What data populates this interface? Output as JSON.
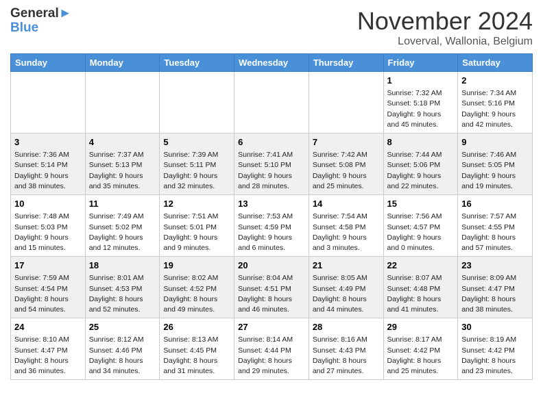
{
  "header": {
    "logo_line1": "General",
    "logo_line2": "Blue",
    "month": "November 2024",
    "location": "Loverval, Wallonia, Belgium"
  },
  "days_of_week": [
    "Sunday",
    "Monday",
    "Tuesday",
    "Wednesday",
    "Thursday",
    "Friday",
    "Saturday"
  ],
  "weeks": [
    [
      {
        "day": "",
        "info": ""
      },
      {
        "day": "",
        "info": ""
      },
      {
        "day": "",
        "info": ""
      },
      {
        "day": "",
        "info": ""
      },
      {
        "day": "",
        "info": ""
      },
      {
        "day": "1",
        "info": "Sunrise: 7:32 AM\nSunset: 5:18 PM\nDaylight: 9 hours and 45 minutes."
      },
      {
        "day": "2",
        "info": "Sunrise: 7:34 AM\nSunset: 5:16 PM\nDaylight: 9 hours and 42 minutes."
      }
    ],
    [
      {
        "day": "3",
        "info": "Sunrise: 7:36 AM\nSunset: 5:14 PM\nDaylight: 9 hours and 38 minutes."
      },
      {
        "day": "4",
        "info": "Sunrise: 7:37 AM\nSunset: 5:13 PM\nDaylight: 9 hours and 35 minutes."
      },
      {
        "day": "5",
        "info": "Sunrise: 7:39 AM\nSunset: 5:11 PM\nDaylight: 9 hours and 32 minutes."
      },
      {
        "day": "6",
        "info": "Sunrise: 7:41 AM\nSunset: 5:10 PM\nDaylight: 9 hours and 28 minutes."
      },
      {
        "day": "7",
        "info": "Sunrise: 7:42 AM\nSunset: 5:08 PM\nDaylight: 9 hours and 25 minutes."
      },
      {
        "day": "8",
        "info": "Sunrise: 7:44 AM\nSunset: 5:06 PM\nDaylight: 9 hours and 22 minutes."
      },
      {
        "day": "9",
        "info": "Sunrise: 7:46 AM\nSunset: 5:05 PM\nDaylight: 9 hours and 19 minutes."
      }
    ],
    [
      {
        "day": "10",
        "info": "Sunrise: 7:48 AM\nSunset: 5:03 PM\nDaylight: 9 hours and 15 minutes."
      },
      {
        "day": "11",
        "info": "Sunrise: 7:49 AM\nSunset: 5:02 PM\nDaylight: 9 hours and 12 minutes."
      },
      {
        "day": "12",
        "info": "Sunrise: 7:51 AM\nSunset: 5:01 PM\nDaylight: 9 hours and 9 minutes."
      },
      {
        "day": "13",
        "info": "Sunrise: 7:53 AM\nSunset: 4:59 PM\nDaylight: 9 hours and 6 minutes."
      },
      {
        "day": "14",
        "info": "Sunrise: 7:54 AM\nSunset: 4:58 PM\nDaylight: 9 hours and 3 minutes."
      },
      {
        "day": "15",
        "info": "Sunrise: 7:56 AM\nSunset: 4:57 PM\nDaylight: 9 hours and 0 minutes."
      },
      {
        "day": "16",
        "info": "Sunrise: 7:57 AM\nSunset: 4:55 PM\nDaylight: 8 hours and 57 minutes."
      }
    ],
    [
      {
        "day": "17",
        "info": "Sunrise: 7:59 AM\nSunset: 4:54 PM\nDaylight: 8 hours and 54 minutes."
      },
      {
        "day": "18",
        "info": "Sunrise: 8:01 AM\nSunset: 4:53 PM\nDaylight: 8 hours and 52 minutes."
      },
      {
        "day": "19",
        "info": "Sunrise: 8:02 AM\nSunset: 4:52 PM\nDaylight: 8 hours and 49 minutes."
      },
      {
        "day": "20",
        "info": "Sunrise: 8:04 AM\nSunset: 4:51 PM\nDaylight: 8 hours and 46 minutes."
      },
      {
        "day": "21",
        "info": "Sunrise: 8:05 AM\nSunset: 4:49 PM\nDaylight: 8 hours and 44 minutes."
      },
      {
        "day": "22",
        "info": "Sunrise: 8:07 AM\nSunset: 4:48 PM\nDaylight: 8 hours and 41 minutes."
      },
      {
        "day": "23",
        "info": "Sunrise: 8:09 AM\nSunset: 4:47 PM\nDaylight: 8 hours and 38 minutes."
      }
    ],
    [
      {
        "day": "24",
        "info": "Sunrise: 8:10 AM\nSunset: 4:47 PM\nDaylight: 8 hours and 36 minutes."
      },
      {
        "day": "25",
        "info": "Sunrise: 8:12 AM\nSunset: 4:46 PM\nDaylight: 8 hours and 34 minutes."
      },
      {
        "day": "26",
        "info": "Sunrise: 8:13 AM\nSunset: 4:45 PM\nDaylight: 8 hours and 31 minutes."
      },
      {
        "day": "27",
        "info": "Sunrise: 8:14 AM\nSunset: 4:44 PM\nDaylight: 8 hours and 29 minutes."
      },
      {
        "day": "28",
        "info": "Sunrise: 8:16 AM\nSunset: 4:43 PM\nDaylight: 8 hours and 27 minutes."
      },
      {
        "day": "29",
        "info": "Sunrise: 8:17 AM\nSunset: 4:42 PM\nDaylight: 8 hours and 25 minutes."
      },
      {
        "day": "30",
        "info": "Sunrise: 8:19 AM\nSunset: 4:42 PM\nDaylight: 8 hours and 23 minutes."
      }
    ]
  ]
}
